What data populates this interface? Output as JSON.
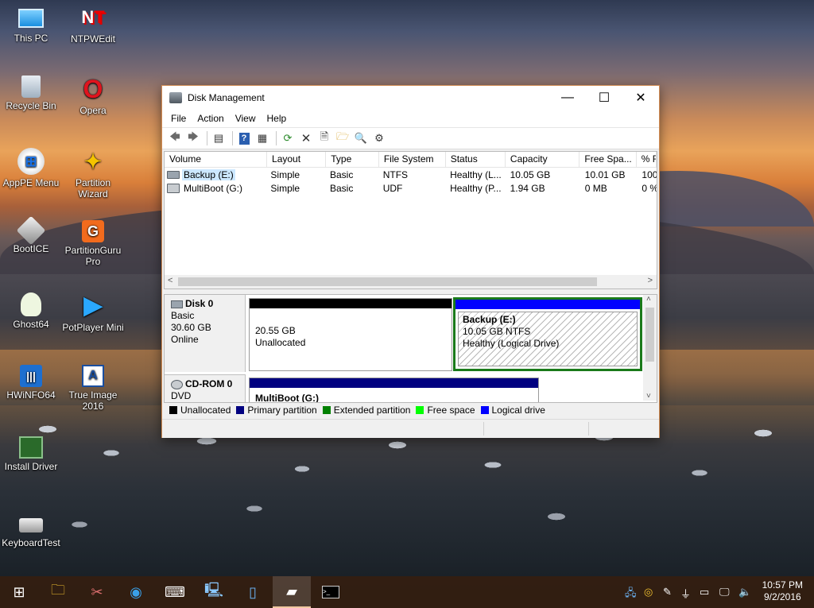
{
  "desktop": {
    "icons": [
      {
        "label": "This PC",
        "icon": "computer-icon"
      },
      {
        "label": "NTPWEdit",
        "icon": "key-icon"
      },
      {
        "label": "Recycle Bin",
        "icon": "recycle-bin-icon"
      },
      {
        "label": "Opera",
        "icon": "opera-icon"
      },
      {
        "label": "AppPE Menu",
        "icon": "windows-logo-icon"
      },
      {
        "label": "Partition Wizard",
        "icon": "wand-icon"
      },
      {
        "label": "BootICE",
        "icon": "disk-icon"
      },
      {
        "label": "PartitionGuru Pro",
        "icon": "partitionguru-icon"
      },
      {
        "label": "Ghost64",
        "icon": "ghost-icon"
      },
      {
        "label": "PotPlayer Mini",
        "icon": "play-icon"
      },
      {
        "label": "HWiNFO64",
        "icon": "hwinfo-icon"
      },
      {
        "label": "True Image 2016",
        "icon": "acronis-icon"
      },
      {
        "label": "Install Driver",
        "icon": "circuit-icon"
      },
      {
        "label": "KeyboardTest",
        "icon": "keyboard-icon"
      }
    ]
  },
  "window": {
    "title": "Disk Management",
    "controls": {
      "minimize": "—",
      "maximize": "☐",
      "close": "✕"
    },
    "menu": [
      "File",
      "Action",
      "View",
      "Help"
    ],
    "toolbar": [
      "back-icon",
      "forward-icon",
      "properties-icon",
      "help-icon",
      "console-icon",
      "refresh-icon",
      "delete-icon",
      "new-icon",
      "open-icon",
      "search-icon",
      "settings-icon"
    ],
    "columns": [
      "Volume",
      "Layout",
      "Type",
      "File System",
      "Status",
      "Capacity",
      "Free Spa...",
      "% F"
    ],
    "rows": [
      {
        "volume": "Backup (E:)",
        "layout": "Simple",
        "type": "Basic",
        "fs": "NTFS",
        "status": "Healthy (L...",
        "capacity": "10.05 GB",
        "free": "10.01 GB",
        "pct": "100"
      },
      {
        "volume": "MultiBoot (G:)",
        "layout": "Simple",
        "type": "Basic",
        "fs": "UDF",
        "status": "Healthy (P...",
        "capacity": "1.94 GB",
        "free": "0 MB",
        "pct": "0 %"
      }
    ],
    "disks": [
      {
        "name": "Disk 0",
        "type": "Basic",
        "size": "30.60 GB",
        "state": "Online",
        "partitions": [
          {
            "line1": "20.55 GB",
            "line2": "Unallocated",
            "color": "#000000"
          },
          {
            "title": "Backup  (E:)",
            "line1": "10.05 GB NTFS",
            "line2": "Healthy (Logical Drive)",
            "color": "#0000ff"
          }
        ]
      },
      {
        "name": "CD-ROM 0",
        "type": "DVD",
        "partitions": [
          {
            "title": "MultiBoot  (G:)",
            "color": "#000080"
          }
        ]
      }
    ],
    "legend": [
      {
        "label": "Unallocated",
        "color": "#000000"
      },
      {
        "label": "Primary partition",
        "color": "#000080"
      },
      {
        "label": "Extended partition",
        "color": "#008000"
      },
      {
        "label": "Free space",
        "color": "#00ff00"
      },
      {
        "label": "Logical drive",
        "color": "#0000ff"
      }
    ]
  },
  "taskbar": {
    "start": "windows-start-icon",
    "apps": [
      "file-explorer-icon",
      "paint-icon",
      "network-icon",
      "keyboard-icon",
      "computer-icon",
      "notepad-icon",
      "disk-management-icon",
      "cmd-icon"
    ],
    "clock": {
      "time": "10:57 PM",
      "date": "9/2/2016"
    }
  }
}
